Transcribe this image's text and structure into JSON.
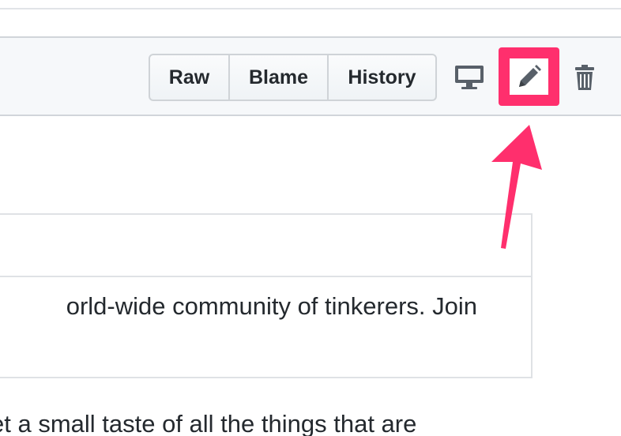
{
  "toolbar": {
    "raw_label": "Raw",
    "blame_label": "Blame",
    "history_label": "History"
  },
  "icons": {
    "display": "desktop-icon",
    "edit": "pencil-icon",
    "delete": "trash-icon"
  },
  "content": {
    "line1": "orld-wide community of tinkerers. Join",
    "line2": "et a small taste of all the things that are"
  },
  "colors": {
    "highlight": "#ff2f6d",
    "header_bg": "#f6f8fa",
    "icon": "#586069"
  }
}
